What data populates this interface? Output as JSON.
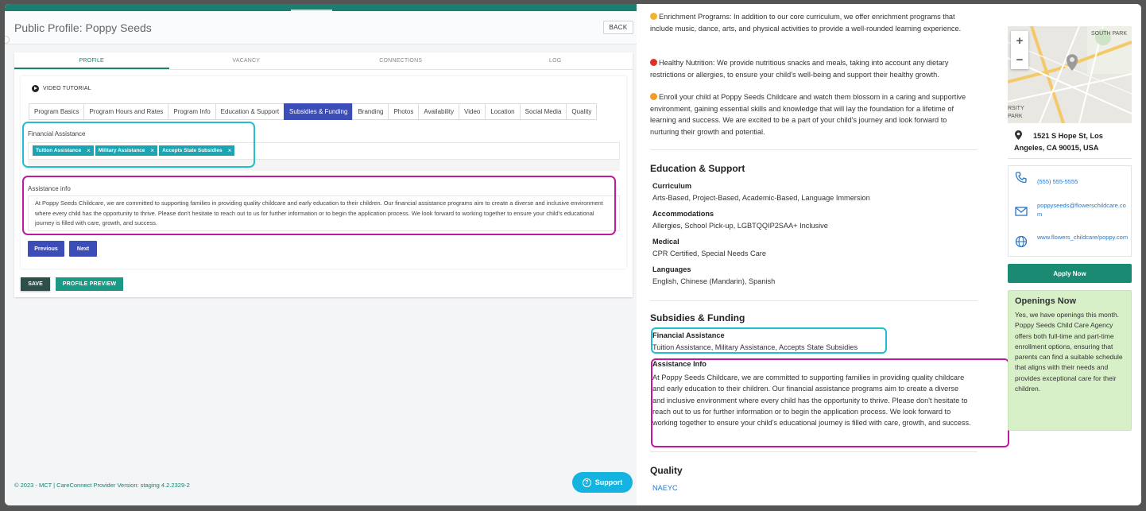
{
  "editor": {
    "page_title": "Public Profile: Poppy Seeds",
    "back_label": "BACK",
    "main_tabs": [
      {
        "label": "PROFILE"
      },
      {
        "label": "VACANCY"
      },
      {
        "label": "CONNECTIONS"
      },
      {
        "label": "LOG"
      }
    ],
    "video_tutorial": "VIDEO TUTORIAL",
    "sub_tabs": [
      {
        "label": "Program Basics"
      },
      {
        "label": "Program Hours and Rates"
      },
      {
        "label": "Program Info"
      },
      {
        "label": "Education & Support"
      },
      {
        "label": "Subsidies & Funding"
      },
      {
        "label": "Branding"
      },
      {
        "label": "Photos"
      },
      {
        "label": "Availability"
      },
      {
        "label": "Video"
      },
      {
        "label": "Location"
      },
      {
        "label": "Social Media"
      },
      {
        "label": "Quality"
      }
    ],
    "financial_assistance_label": "Financial Assistance",
    "financial_assistance_chips": [
      {
        "label": "Tuition Assistance"
      },
      {
        "label": "Military Assistance"
      },
      {
        "label": "Accepts State Subsidies"
      }
    ],
    "chip_remove": "×",
    "assistance_info_label": "Assistance info",
    "assistance_info_text": "At Poppy Seeds Childcare, we are committed to supporting families in providing quality childcare and early education to their children. Our financial assistance programs aim to create a diverse and inclusive environment where every child has the opportunity to thrive. Please don't hesitate to reach out to us for further information or to begin the application process. We look forward to working together to ensure your child's educational journey is filled with care, growth, and success.",
    "previous_label": "Previous",
    "next_label": "Next",
    "save_label": "SAVE",
    "preview_label": "PROFILE PREVIEW",
    "footer": "© 2023 - MCT | CareConnect Provider Version: staging 4.2.2329-2",
    "support_label": "Support"
  },
  "preview": {
    "enrichment_text": "Enrichment Programs: In addition to our core curriculum, we offer enrichment programs that include music, dance, arts, and physical activities to provide a well-rounded learning experience.",
    "nutrition_text": "Healthy Nutrition: We provide nutritious snacks and meals, taking into account any dietary restrictions or allergies, to ensure your child's well-being and support their healthy growth.",
    "enroll_text": "Enroll your child at Poppy Seeds Childcare and watch them blossom in a caring and supportive environment, gaining essential skills and knowledge that will lay the foundation for a lifetime of learning and success. We are excited to be a part of your child's journey and look forward to nurturing their growth and potential.",
    "education_title": "Education & Support",
    "curriculum_label": "Curriculum",
    "curriculum_value": "Arts-Based, Project-Based, Academic-Based, Language Immersion",
    "accommodations_label": "Accommodations",
    "accommodations_value": "Allergies, School Pick-up, LGBTQQIP2SAA+ Inclusive",
    "medical_label": "Medical",
    "medical_value": "CPR Certified, Special Needs Care",
    "languages_label": "Languages",
    "languages_value": "English, Chinese (Mandarin), Spanish",
    "subsidies_title": "Subsidies & Funding",
    "fa_label": "Financial Assistance",
    "fa_value": "Tuition Assistance, Military Assistance, Accepts State Subsidies",
    "ai_label": "Assistance Info",
    "ai_value": "At Poppy Seeds Childcare, we are committed to supporting families in providing quality childcare and early education to their children. Our financial assistance programs aim to create a diverse and inclusive environment where every child has the opportunity to thrive. Please don't hesitate to reach out to us for further information or to begin the application process. We look forward to working together to ensure your child's educational journey is filled with care, growth, and success.",
    "quality_title": "Quality",
    "quality_value": "NAEYC",
    "map_labels": {
      "south_park": "SOUTH PARK",
      "rsity": "RSITY",
      "park": "PARK"
    },
    "address": "1521 S Hope St, Los Angeles, CA 90015, USA",
    "phone": "(555) 555-5555",
    "email": "poppyseeds@flowerschildcare.com",
    "website": "www.flowers_childcare/poppy.com",
    "apply_label": "Apply Now",
    "openings_title": "Openings Now",
    "openings_text": "Yes, we have openings this month.\nPoppy Seeds Child Care Agency offers both full-time and part-time enrollment options, ensuring that parents can find a suitable schedule that aligns with their needs and provides exceptional care for their children."
  },
  "colors": {
    "brand_teal": "#1a7f6f",
    "active_tab_blue": "#3d4db7",
    "chip_cyan": "#1aa5b5",
    "highlight_cyan": "#1fbfcf",
    "highlight_magenta": "#c2189c",
    "openings_green": "#d8f0c8",
    "support_blue": "#14b3e0"
  }
}
